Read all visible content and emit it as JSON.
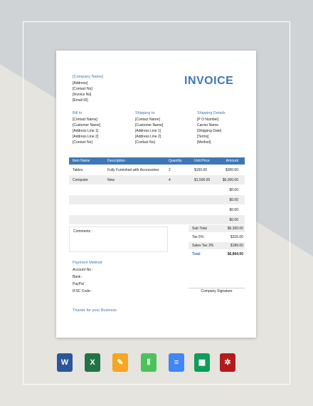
{
  "company": {
    "name": "[Company Name]",
    "lines": [
      "[Address]",
      "[Contact No]",
      "[Invoice No]",
      "[Email ID]"
    ]
  },
  "title": "INVOICE",
  "bill_to": {
    "heading": "Bill to",
    "lines": [
      "[Contact Name]",
      "[Customer Name]",
      "[Address Line 1]",
      "[Address Line 2]",
      "[Contact No]"
    ]
  },
  "shipping_to": {
    "heading": "Shipping to",
    "lines": [
      "[Contact Name]",
      "[Customer Name]",
      "[Address Line 1]",
      "[Address Line 2]",
      "[Contact No]"
    ]
  },
  "shipping_details": {
    "heading": "Shipping Details",
    "lines": [
      "[P O Number]",
      "Carrier Name",
      "[Shipping Date]",
      "[Terms]",
      "[Method]"
    ]
  },
  "table": {
    "headers": [
      "Item Name",
      "Description",
      "Quantity",
      "Unit Price",
      "Amount"
    ],
    "rows": [
      [
        "Tables",
        "Fully Furnished with Accessories",
        "2",
        "$150.00",
        "$300.00"
      ],
      [
        "Computer",
        "New",
        "4",
        "$1,500.00",
        "$6,000.00"
      ],
      [
        "",
        "",
        "",
        "",
        "$0.00"
      ],
      [
        "",
        "",
        "",
        "",
        "$0.00"
      ],
      [
        "",
        "",
        "",
        "",
        "$0.00"
      ],
      [
        "",
        "",
        "",
        "",
        "$0.00"
      ]
    ]
  },
  "comments_label": "Comments :",
  "totals": [
    {
      "label": "Sub Total",
      "value": "$6,300.00"
    },
    {
      "label": "Tax 5%",
      "value": "$315.00"
    },
    {
      "label": "Sales Tax 3%",
      "value": "$189.00"
    },
    {
      "label": "Total",
      "value": "$6,804.00"
    }
  ],
  "payment": {
    "heading": "Payment Method",
    "lines": [
      "Account No :",
      "Bank :",
      "PayPal :",
      "IFSC Code :"
    ]
  },
  "signature_label": "Company Signature",
  "thanks": "Thanks for your Business",
  "app_icons": [
    {
      "name": "word-icon",
      "glyph": "W",
      "color": "#2b579a"
    },
    {
      "name": "excel-icon",
      "glyph": "X",
      "color": "#217346"
    },
    {
      "name": "pages-icon",
      "glyph": "✎",
      "color": "#f5a623"
    },
    {
      "name": "numbers-icon",
      "glyph": "Ⅱ",
      "color": "#4cc35a"
    },
    {
      "name": "google-docs-icon",
      "glyph": "≡",
      "color": "#4285f4"
    },
    {
      "name": "google-sheets-icon",
      "glyph": "▦",
      "color": "#0f9d58"
    },
    {
      "name": "pdf-icon",
      "glyph": "✲",
      "color": "#b31b1b"
    }
  ]
}
